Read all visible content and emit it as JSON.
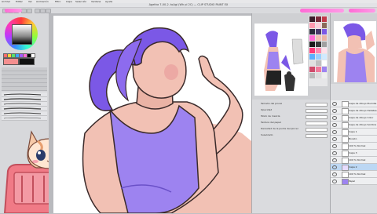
{
  "window": {
    "title": "Agetha 7-00-2. toAgi (Wh pl 2C) — CLIP STUDIO PAINT EX"
  },
  "menu": [
    "Archivo",
    "Editar",
    "Ver",
    "Animación",
    "Filtro",
    "Capa",
    "Selección",
    "Ventana",
    "Ayuda"
  ],
  "properties": {
    "rows": [
      "Tamaño del pincel",
      "Opacidad",
      "Modo de mezcla",
      "Textura del papel",
      "Densidad de la punta del pincel",
      "Suavizado"
    ],
    "values": [
      "",
      "",
      "Predeterminado",
      "Papel",
      "",
      ""
    ]
  },
  "layers": [
    {
      "name": "Capa de dibujo Plumilla",
      "selected": false
    },
    {
      "name": "Capa de dibujo Detalles",
      "selected": false
    },
    {
      "name": "Capa de dibujo Color base",
      "selected": false
    },
    {
      "name": "Capa de dibujo Sombra",
      "selected": false
    },
    {
      "name": "Capa 1",
      "selected": false
    },
    {
      "name": "Boceto",
      "selected": false
    },
    {
      "name": "100 % Normal",
      "selected": false
    },
    {
      "name": "Capa 3",
      "selected": false
    },
    {
      "name": "100 % Normal",
      "selected": false
    },
    {
      "name": "Capa 2",
      "selected": true
    },
    {
      "name": "100 % Normal",
      "selected": false
    },
    {
      "name": "Papel",
      "selected": false
    }
  ],
  "colors": {
    "accent_pink": "#ff7fdd",
    "hair": "#7b58e6",
    "top": "#9d83f0",
    "skin": "#f2c1b4"
  }
}
